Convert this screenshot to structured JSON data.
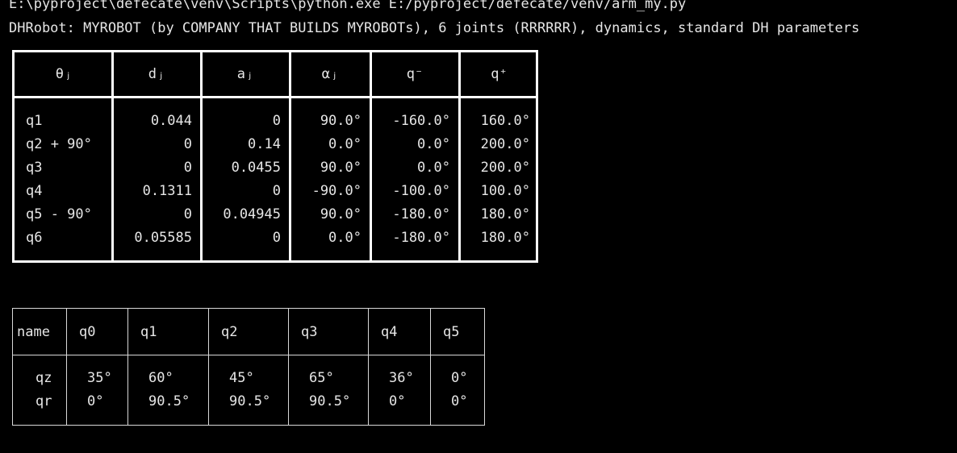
{
  "console": {
    "command_line": "E:\\pyproject\\defecate\\venv\\Scripts\\python.exe E:/pyproject/defecate/venv/arm_my.py",
    "robot_description": "DHRobot: MYROBOT (by COMPANY THAT BUILDS MYROBOTs), 6 joints (RRRRRR), dynamics, standard DH parameters"
  },
  "dh_table": {
    "headers": [
      "θⱼ",
      "dⱼ",
      "aⱼ",
      "⍺ⱼ",
      "q⁻",
      "q⁺"
    ],
    "rows": [
      [
        "q1",
        "0.044",
        "0",
        "90.0°",
        "-160.0°",
        "160.0°"
      ],
      [
        "q2 + 90°",
        "0",
        "0.14",
        "0.0°",
        "0.0°",
        "200.0°"
      ],
      [
        "q3",
        "0",
        "0.0455",
        "90.0°",
        "0.0°",
        "200.0°"
      ],
      [
        "q4",
        "0.1311",
        "0",
        "-90.0°",
        "-100.0°",
        "100.0°"
      ],
      [
        "q5 - 90°",
        "0",
        "0.04945",
        "90.0°",
        "-180.0°",
        "180.0°"
      ],
      [
        "q6",
        "0.05585",
        "0",
        "0.0°",
        "-180.0°",
        "180.0°"
      ]
    ]
  },
  "config_table": {
    "headers": [
      "name",
      "q0",
      "q1",
      "q2",
      "q3",
      "q4",
      "q5"
    ],
    "rows": [
      [
        "qz",
        "35°",
        "60°",
        "45°",
        "65°",
        "36°",
        "0°"
      ],
      [
        "qr",
        "0°",
        "90.5°",
        "90.5°",
        "90.5°",
        "0°",
        "0°"
      ]
    ]
  }
}
